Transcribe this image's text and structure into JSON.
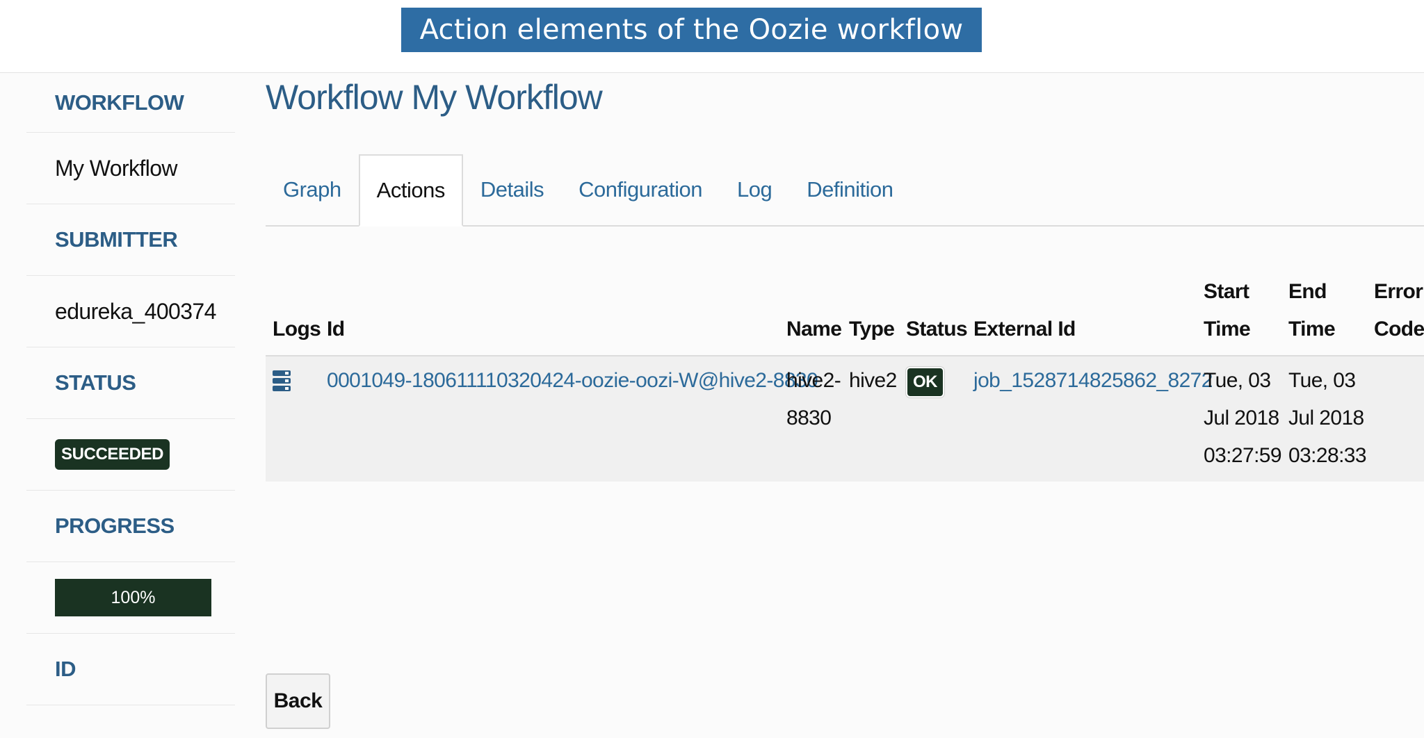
{
  "banner": {
    "title": "Action elements of the Oozie workflow"
  },
  "sidebar": {
    "workflow_heading": "WORKFLOW",
    "workflow_name": "My Workflow",
    "submitter_heading": "SUBMITTER",
    "submitter_value": "edureka_400374",
    "status_heading": "STATUS",
    "status_value": "SUCCEEDED",
    "progress_heading": "PROGRESS",
    "progress_label": "100%",
    "progress_fraction": 1.0,
    "id_heading": "ID"
  },
  "page": {
    "title": "Workflow My Workflow"
  },
  "tabs": [
    {
      "label": "Graph",
      "active": false
    },
    {
      "label": "Actions",
      "active": true
    },
    {
      "label": "Details",
      "active": false
    },
    {
      "label": "Configuration",
      "active": false
    },
    {
      "label": "Log",
      "active": false
    },
    {
      "label": "Definition",
      "active": false
    }
  ],
  "table": {
    "headers": {
      "logs": "Logs",
      "id": "Id",
      "name": "Name",
      "type": "Type",
      "status": "Status",
      "external_id": "External Id",
      "start_time_1": "Start",
      "start_time_2": "Time",
      "end_time_1": "End",
      "end_time_2": "Time",
      "error_code_1": "Error",
      "error_code_2": "Code"
    },
    "rows": [
      {
        "log_icon": "log-list-icon",
        "id": "0001049-180611110320424-oozie-oozi-W@hive2-8830",
        "name_1": "hive2-",
        "name_2": "8830",
        "type": "hive2",
        "status": "OK",
        "external_id": "job_1528714825862_8272",
        "start_1": "Tue, 03",
        "start_2": "Jul 2018",
        "start_3": "03:27:59",
        "end_1": "Tue, 03",
        "end_2": "Jul 2018",
        "end_3": "03:28:33"
      }
    ]
  },
  "buttons": {
    "back": "Back"
  },
  "colors": {
    "banner_bg": "#2e6da4",
    "heading_blue": "#2c5d86",
    "link_blue": "#2c6a9a",
    "status_dark_green": "#1a3322"
  }
}
